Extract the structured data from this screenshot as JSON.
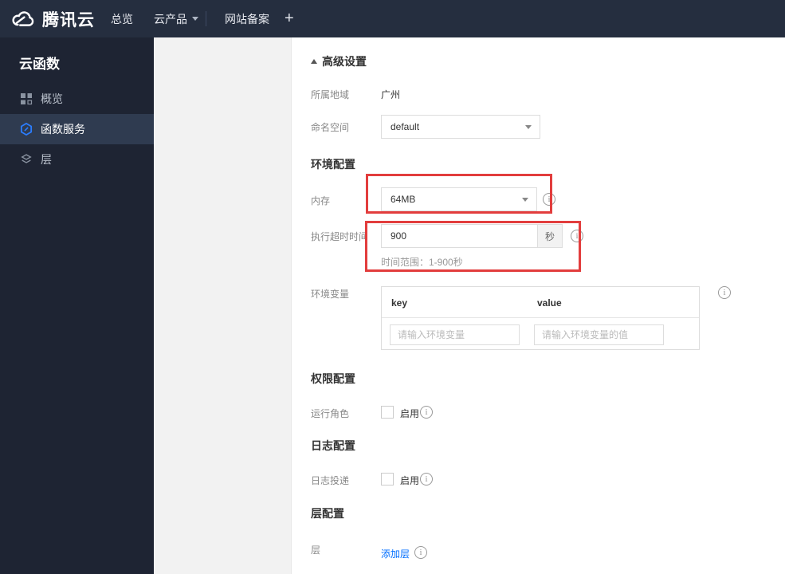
{
  "topbar": {
    "brand": "腾讯云",
    "overview": "总览",
    "products": "云产品",
    "icp": "网站备案",
    "plus": "+"
  },
  "sidebar": {
    "title": "云函数",
    "items": [
      {
        "label": "概览",
        "icon": "grid-icon",
        "active": false
      },
      {
        "label": "函数服务",
        "icon": "function-icon",
        "active": true
      },
      {
        "label": "层",
        "icon": "layers-icon",
        "active": false
      }
    ]
  },
  "main": {
    "advanced": "高级设置",
    "region_label": "所属地域",
    "region_value": "广州",
    "namespace_label": "命名空间",
    "namespace_value": "default",
    "section_env": "环境配置",
    "memory_label": "内存",
    "memory_value": "64MB",
    "timeout_label": "执行超时时间",
    "timeout_value": "900",
    "timeout_unit": "秒",
    "timeout_hint": "时间范围：1-900秒",
    "env_label": "环境变量",
    "col_key": "key",
    "col_value": "value",
    "key_placeholder": "请输入环境变量",
    "value_placeholder": "请输入环境变量的值",
    "section_perm": "权限配置",
    "role_label": "运行角色",
    "role_enable": "启用",
    "section_log": "日志配置",
    "log_label": "日志投递",
    "log_enable": "启用",
    "section_layer": "层配置",
    "layer_label": "层",
    "add_layer": "添加层",
    "info_glyph": "i"
  },
  "colors": {
    "accent_blue": "#006eff",
    "annotation_red": "#e23d3d",
    "topbar_bg": "#252e3f",
    "sidebar_bg": "#1e2433",
    "sidebar_active_bg": "#2f3b50",
    "gray_panel": "#f2f2f2"
  }
}
